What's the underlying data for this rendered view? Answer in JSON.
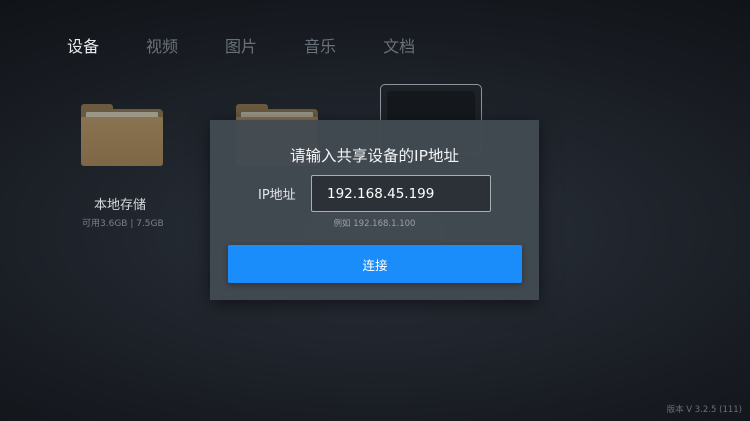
{
  "tabs": [
    {
      "label": "设备",
      "active": true
    },
    {
      "label": "视频",
      "active": false
    },
    {
      "label": "图片",
      "active": false
    },
    {
      "label": "音乐",
      "active": false
    },
    {
      "label": "文档",
      "active": false
    }
  ],
  "tiles": [
    {
      "title": "本地存储",
      "subtitle": "可用3.6GB | 7.5GB",
      "icon": "folder-icon"
    },
    {
      "title": "",
      "subtitle": "",
      "icon": "folder-icon"
    },
    {
      "title": "",
      "subtitle": "",
      "icon": "screen-icon"
    }
  ],
  "dialog": {
    "title": "请输入共享设备的IP地址",
    "ip_label": "IP地址",
    "ip_value": "192.168.45.199",
    "hint": "例如 192.168.1.100",
    "connect_label": "连接"
  },
  "footer": {
    "version": "版本 V 3.2.5 (111)"
  },
  "colors": {
    "accent": "#1b8dfb",
    "folder": "#8a7350"
  }
}
